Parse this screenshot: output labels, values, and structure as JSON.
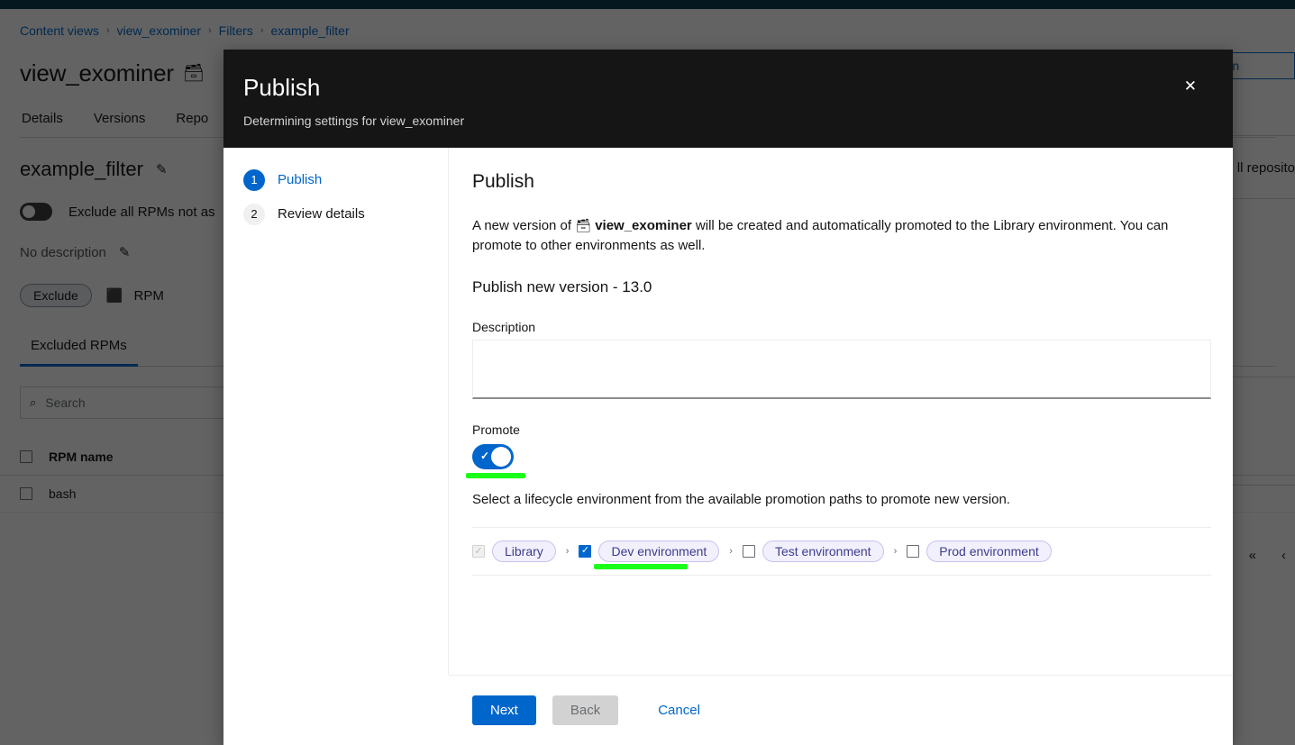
{
  "background": {
    "breadcrumb": [
      {
        "label": "Content views"
      },
      {
        "label": "view_exominer"
      },
      {
        "label": "Filters"
      },
      {
        "label": "example_filter"
      }
    ],
    "breadcrumb_separator": "›",
    "page_title": "view_exominer",
    "page_title_icon": "🗃",
    "tabs": [
      {
        "label": "Details"
      },
      {
        "label": "Versions"
      },
      {
        "label": "Repo"
      }
    ],
    "filter_title": "example_filter",
    "edit_icon": "✎",
    "exclude_toggle_label": "Exclude all RPMs not as",
    "description_text": "No description",
    "exclude_pill": "Exclude",
    "content_type": "RPM",
    "content_type_icon": "⬛",
    "subtab_active": "Excluded RPMs",
    "search_placeholder": "Search",
    "search_icon": "⌕",
    "table": {
      "columns": [
        "RPM name"
      ],
      "rows": [
        [
          "bash"
        ]
      ]
    },
    "right_button": "version",
    "right_text": "ll reposito",
    "pager": [
      "«",
      "‹"
    ]
  },
  "modal": {
    "title": "Publish",
    "subtitle": "Determining settings for view_exominer",
    "close_label": "✕",
    "steps": [
      {
        "number": "1",
        "label": "Publish",
        "state": "current"
      },
      {
        "number": "2",
        "label": "Review details",
        "state": "idle"
      }
    ],
    "section_title": "Publish",
    "intro_prefix": "A new version of",
    "intro_icon": "🗃",
    "intro_name": "view_exominer",
    "intro_suffix": "will be created and automatically promoted to the Library environment. You can promote to other environments as well.",
    "publish_version_heading": "Publish new version - 13.0",
    "description_label": "Description",
    "description_value": "",
    "description_placeholder": "",
    "promote_label": "Promote",
    "promote_enabled": true,
    "promote_toggle_icon": "✓",
    "select_help": "Select a lifecycle environment from the available promotion paths to promote new version.",
    "environments": [
      {
        "label": "Library",
        "checked": true,
        "disabled": true,
        "check_icon": "✓"
      },
      {
        "label": "Dev environment",
        "checked": true,
        "disabled": false,
        "check_icon": "✓"
      },
      {
        "label": "Test environment",
        "checked": false,
        "disabled": false,
        "check_icon": ""
      },
      {
        "label": "Prod environment",
        "checked": false,
        "disabled": false,
        "check_icon": ""
      }
    ],
    "env_arrow": "›",
    "footer": {
      "next_label": "Next",
      "back_label": "Back",
      "cancel_label": "Cancel"
    }
  },
  "colors": {
    "accent_blue": "#0066cc",
    "header_dark": "#151515",
    "masthead": "#0a3c4d",
    "highlight_green": "#1aff1a",
    "pill_purple_bg": "#f2f0fc",
    "pill_purple_text": "#3c3d8f"
  }
}
